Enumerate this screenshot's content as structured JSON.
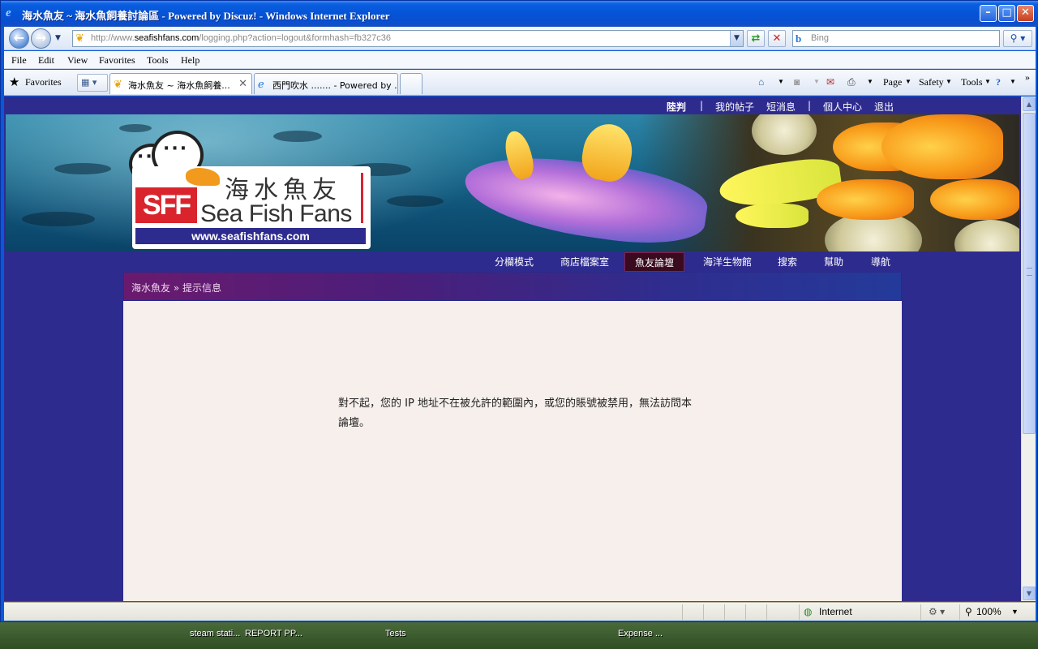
{
  "window": {
    "title": "海水魚友 ~ 海水魚飼養討論區 - Powered by Discuz! - Windows Internet Explorer",
    "minimize": "–",
    "maximize": "□",
    "close": "✕"
  },
  "address": {
    "url_prefix": "http://www.",
    "url_domain": "seafishfans.com",
    "url_path": "/logging.php?action=logout&formhash=fb327c36"
  },
  "search": {
    "placeholder": "Bing"
  },
  "menu": [
    "File",
    "Edit",
    "View",
    "Favorites",
    "Tools",
    "Help"
  ],
  "favorites": {
    "label": "Favorites"
  },
  "tabs": [
    {
      "label": "海水魚友 ~ 海水魚飼養...",
      "active": true
    },
    {
      "label": "西門吹水 ....... - Powered by ...",
      "active": false
    }
  ],
  "commandbar": {
    "page": "Page",
    "safety": "Safety",
    "tools": "Tools"
  },
  "userbar": {
    "login": "陸判",
    "sep1": "|",
    "my_posts": "我的帖子",
    "messages": "短消息",
    "sep2": "|",
    "profile": "個人中心",
    "logout": "退出"
  },
  "logo": {
    "sff": "SFF",
    "chinese": "海水魚友",
    "english": "Sea Fish Fans",
    "url": "www.seafishfans.com"
  },
  "nav": [
    "分欄模式",
    "商店檔案室",
    "魚友論壇",
    "海洋生物館",
    "搜索",
    "幫助",
    "導航"
  ],
  "breadcrumb": {
    "home": "海水魚友",
    "sep": "»",
    "current": "提示信息"
  },
  "message": "對不起，您的 IP 地址不在被允許的範圍內，或您的賬號被禁用，無法訪問本論壇。",
  "status": {
    "zone": "Internet",
    "zoom": "100%"
  },
  "taskbar": [
    "steam stati...",
    "REPORT PP...",
    "Tests",
    "Expense ..."
  ],
  "colors": {
    "page_bg": "#2e2b8f",
    "content_bg": "#f6efec",
    "nav_current": "#3a0a1e",
    "logo_red": "#d9242d"
  }
}
